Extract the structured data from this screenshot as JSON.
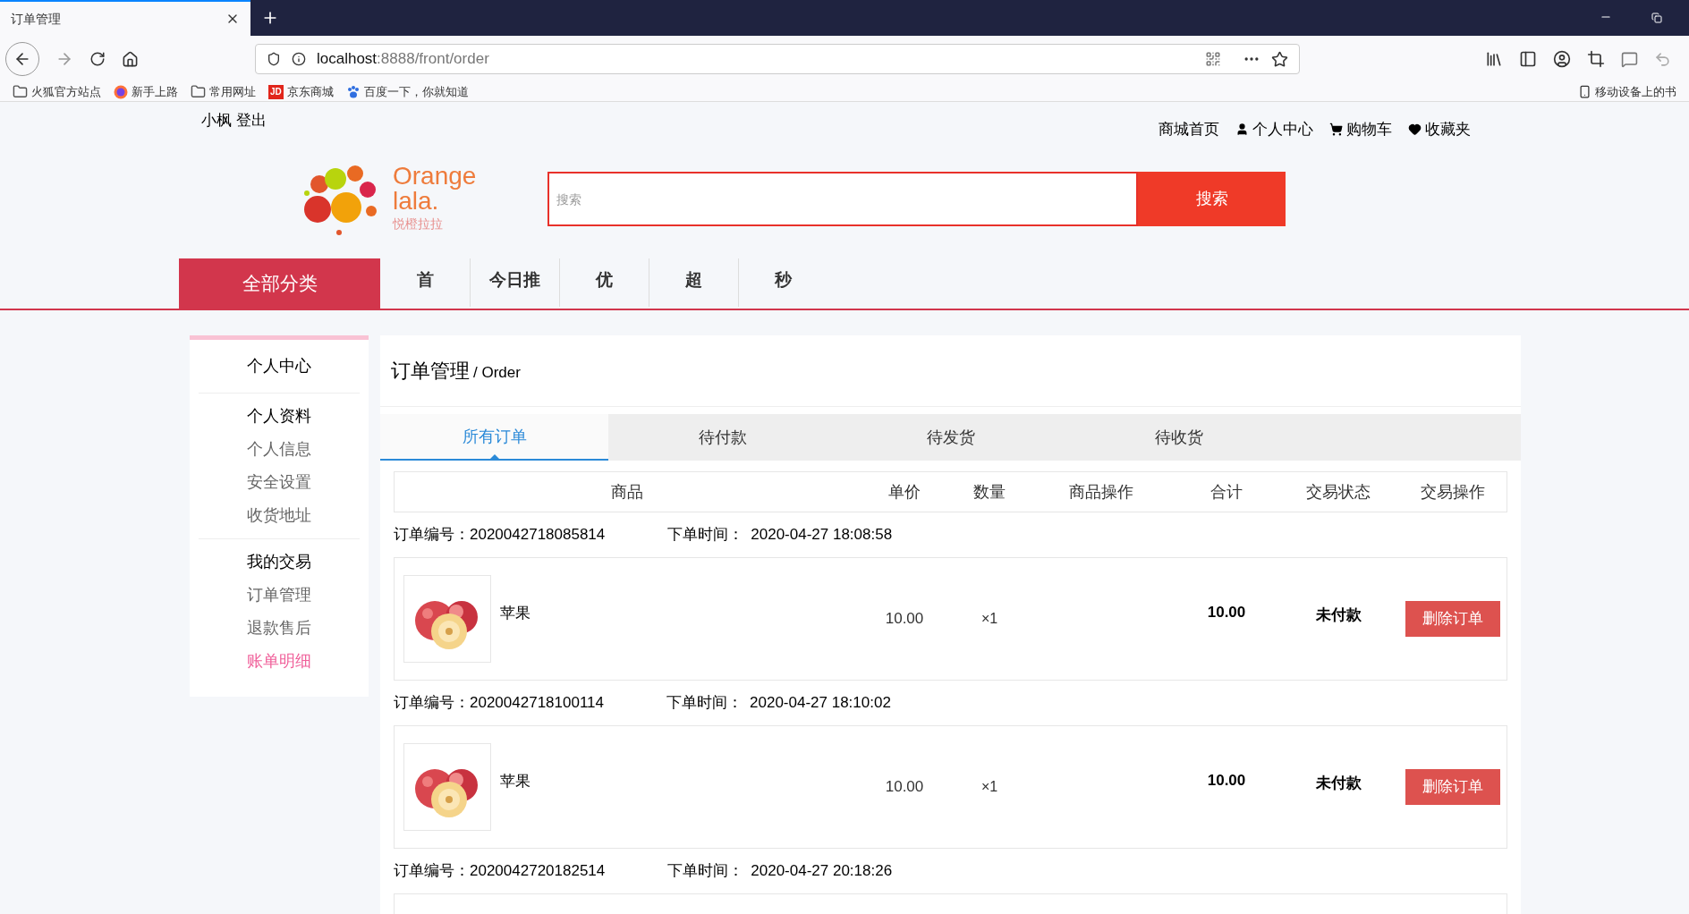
{
  "browser": {
    "tabs": [
      {
        "title": "订单管理",
        "selected": true
      }
    ],
    "address": {
      "host": "localhost",
      "path": ":8888/front/order"
    },
    "bookmarks": [
      {
        "kind": "folder",
        "label": "火狐官方站点"
      },
      {
        "kind": "browser",
        "label": "新手上路"
      },
      {
        "kind": "folder",
        "label": "常用网址"
      },
      {
        "kind": "jd",
        "label": "京东商城",
        "badge": "JD"
      },
      {
        "kind": "paw",
        "label": "百度一下，你就知道"
      },
      {
        "kind": "mobile",
        "label": "移动设备上的书"
      }
    ]
  },
  "topbar": {
    "user": "小枫 登出",
    "links": [
      {
        "kind": "text",
        "label": "商城首页"
      },
      {
        "kind": "user",
        "label": "个人中心"
      },
      {
        "kind": "cart",
        "label": "购物车"
      },
      {
        "kind": "heart",
        "label": "收藏夹"
      }
    ]
  },
  "logo": {
    "line1": "Orange",
    "line2": "lala.",
    "tagline": "悦橙拉拉"
  },
  "search": {
    "placeholder": "搜索",
    "button": "搜索"
  },
  "nav": {
    "all": "全部分类",
    "items": [
      "首",
      "今日推",
      "优",
      "超",
      "秒"
    ]
  },
  "sidebar": {
    "title": "个人中心",
    "groups": [
      {
        "title": "个人资料",
        "items": [
          {
            "label": "个人信息",
            "selected": false
          },
          {
            "label": "安全设置",
            "selected": false
          },
          {
            "label": "收货地址",
            "selected": false
          }
        ]
      },
      {
        "title": "我的交易",
        "items": [
          {
            "label": "订单管理",
            "selected": false
          },
          {
            "label": "退款售后",
            "selected": false
          },
          {
            "label": "账单明细",
            "selected": true
          }
        ]
      }
    ]
  },
  "main": {
    "title": "订单管理",
    "subtitle": "/ Order",
    "tabs": [
      {
        "label": "所有订单",
        "selected": true
      },
      {
        "label": "待付款",
        "selected": false
      },
      {
        "label": "待发货",
        "selected": false
      },
      {
        "label": "待收货",
        "selected": false
      }
    ],
    "columns": [
      "商品",
      "单价",
      "数量",
      "商品操作",
      "合计",
      "交易状态",
      "交易操作"
    ],
    "orders": [
      {
        "number_label": "订单编号：",
        "number": "2020042718085814",
        "time_label": "下单时间：",
        "time": "2020-04-27 18:08:58",
        "items": [
          {
            "kind": "picture",
            "name": "苹果",
            "price": "10.00",
            "qty": "×1",
            "total": "10.00",
            "status": "未付款",
            "action": "删除订单"
          }
        ]
      },
      {
        "number_label": "订单编号：",
        "number": "2020042718100114",
        "time_label": "下单时间：",
        "time": "2020-04-27 18:10:02",
        "items": [
          {
            "kind": "picture",
            "name": "苹果",
            "price": "10.00",
            "qty": "×1",
            "total": "10.00",
            "status": "未付款",
            "action": "删除订单"
          }
        ]
      },
      {
        "number_label": "订单编号：",
        "number": "2020042720182514",
        "time_label": "下单时间：",
        "time": "2020-04-27 20:18:26"
      }
    ]
  }
}
